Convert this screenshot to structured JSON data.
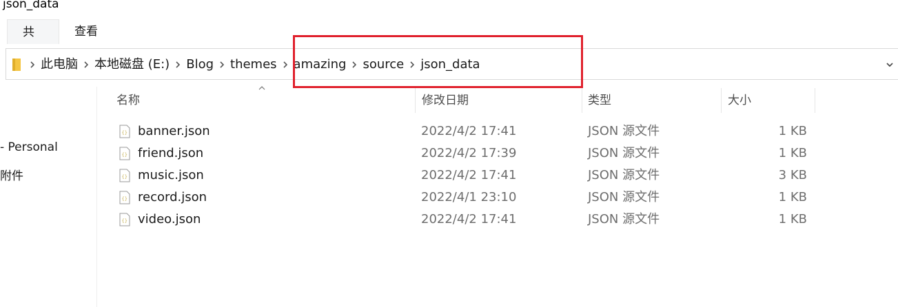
{
  "window": {
    "title": "json_data"
  },
  "ribbon": {
    "tabs": [
      "共享",
      "查看"
    ]
  },
  "address": {
    "crumbs": [
      "此电脑",
      "本地磁盘 (E:)",
      "Blog",
      "themes",
      "amazing",
      "source",
      "json_data"
    ],
    "separator": ">",
    "dropdown": "⌄"
  },
  "highlight": {
    "color": "#e0202c"
  },
  "navigation": {
    "items": [
      "- Personal",
      "附件"
    ]
  },
  "columns": {
    "name": "名称",
    "date": "修改日期",
    "type": "类型",
    "size": "大小"
  },
  "files": [
    {
      "name": "banner.json",
      "date": "2022/4/2 17:41",
      "type": "JSON 源文件",
      "size": "1 KB"
    },
    {
      "name": "friend.json",
      "date": "2022/4/2 17:39",
      "type": "JSON 源文件",
      "size": "1 KB"
    },
    {
      "name": "music.json",
      "date": "2022/4/2 17:41",
      "type": "JSON 源文件",
      "size": "3 KB"
    },
    {
      "name": "record.json",
      "date": "2022/4/1 23:10",
      "type": "JSON 源文件",
      "size": "1 KB"
    },
    {
      "name": "video.json",
      "date": "2022/4/2 17:41",
      "type": "JSON 源文件",
      "size": "1 KB"
    }
  ],
  "icons": {
    "folder": "folder-icon",
    "file": "json-file-icon",
    "sort": "sort-up-icon",
    "sort_glyph": "^"
  },
  "colors": {
    "accent_folder": "#f4c542",
    "file_icon_accent": "#c9b458"
  }
}
